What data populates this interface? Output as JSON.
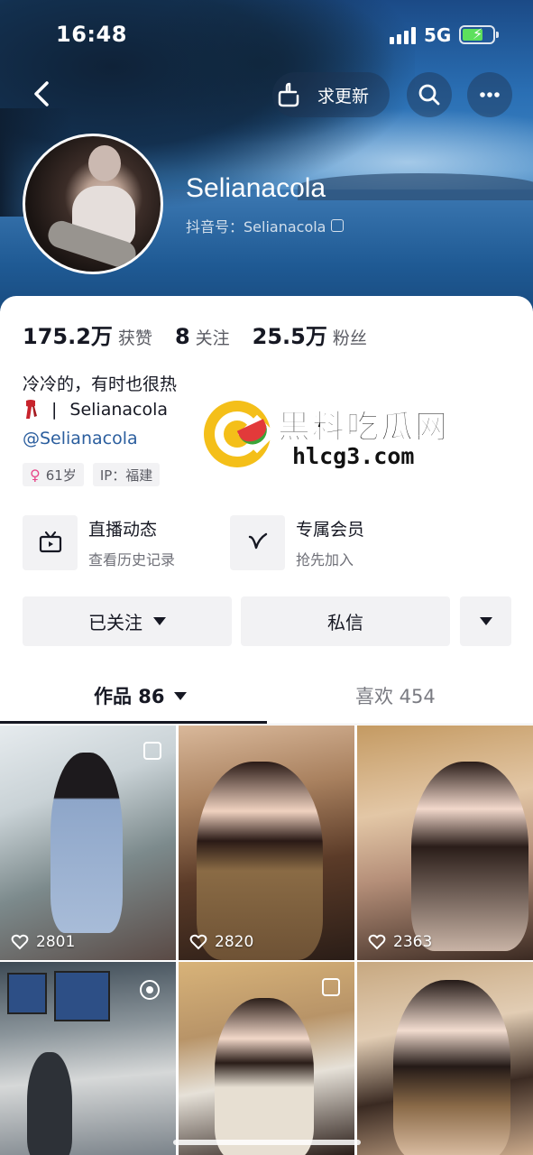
{
  "status_bar": {
    "time": "16:48",
    "network": "5G"
  },
  "header": {
    "update_label": "求更新",
    "username": "Selianacola",
    "douyin_id": "抖音号：Selianacola"
  },
  "stats": [
    {
      "num": "175.2万",
      "label": "获赞"
    },
    {
      "num": "8",
      "label": "关注"
    },
    {
      "num": "25.5万",
      "label": "粉丝"
    }
  ],
  "bio": {
    "line1": "冷冷的，有时也很热",
    "line2_sep": "|",
    "line2_text": "Selianacola",
    "link": "@Selianacola"
  },
  "tags": {
    "age": "61岁",
    "ip": "IP：福建"
  },
  "watermark": {
    "title": "黑料吃瓜网",
    "url": "hlcg3.com"
  },
  "features": {
    "live": {
      "title": "直播动态",
      "sub": "查看历史记录"
    },
    "vip": {
      "title": "专属会员",
      "sub": "抢先加入"
    }
  },
  "buttons": {
    "follow": "已关注",
    "message": "私信"
  },
  "tabs": {
    "works": "作品 86",
    "likes": "喜欢 454"
  },
  "grid": [
    {
      "likes": "2801"
    },
    {
      "likes": "2820"
    },
    {
      "likes": "2363"
    }
  ],
  "colors": {
    "accent_link": "#2b5e9e",
    "female_icon": "#e8478b",
    "battery": "#5de05d"
  }
}
